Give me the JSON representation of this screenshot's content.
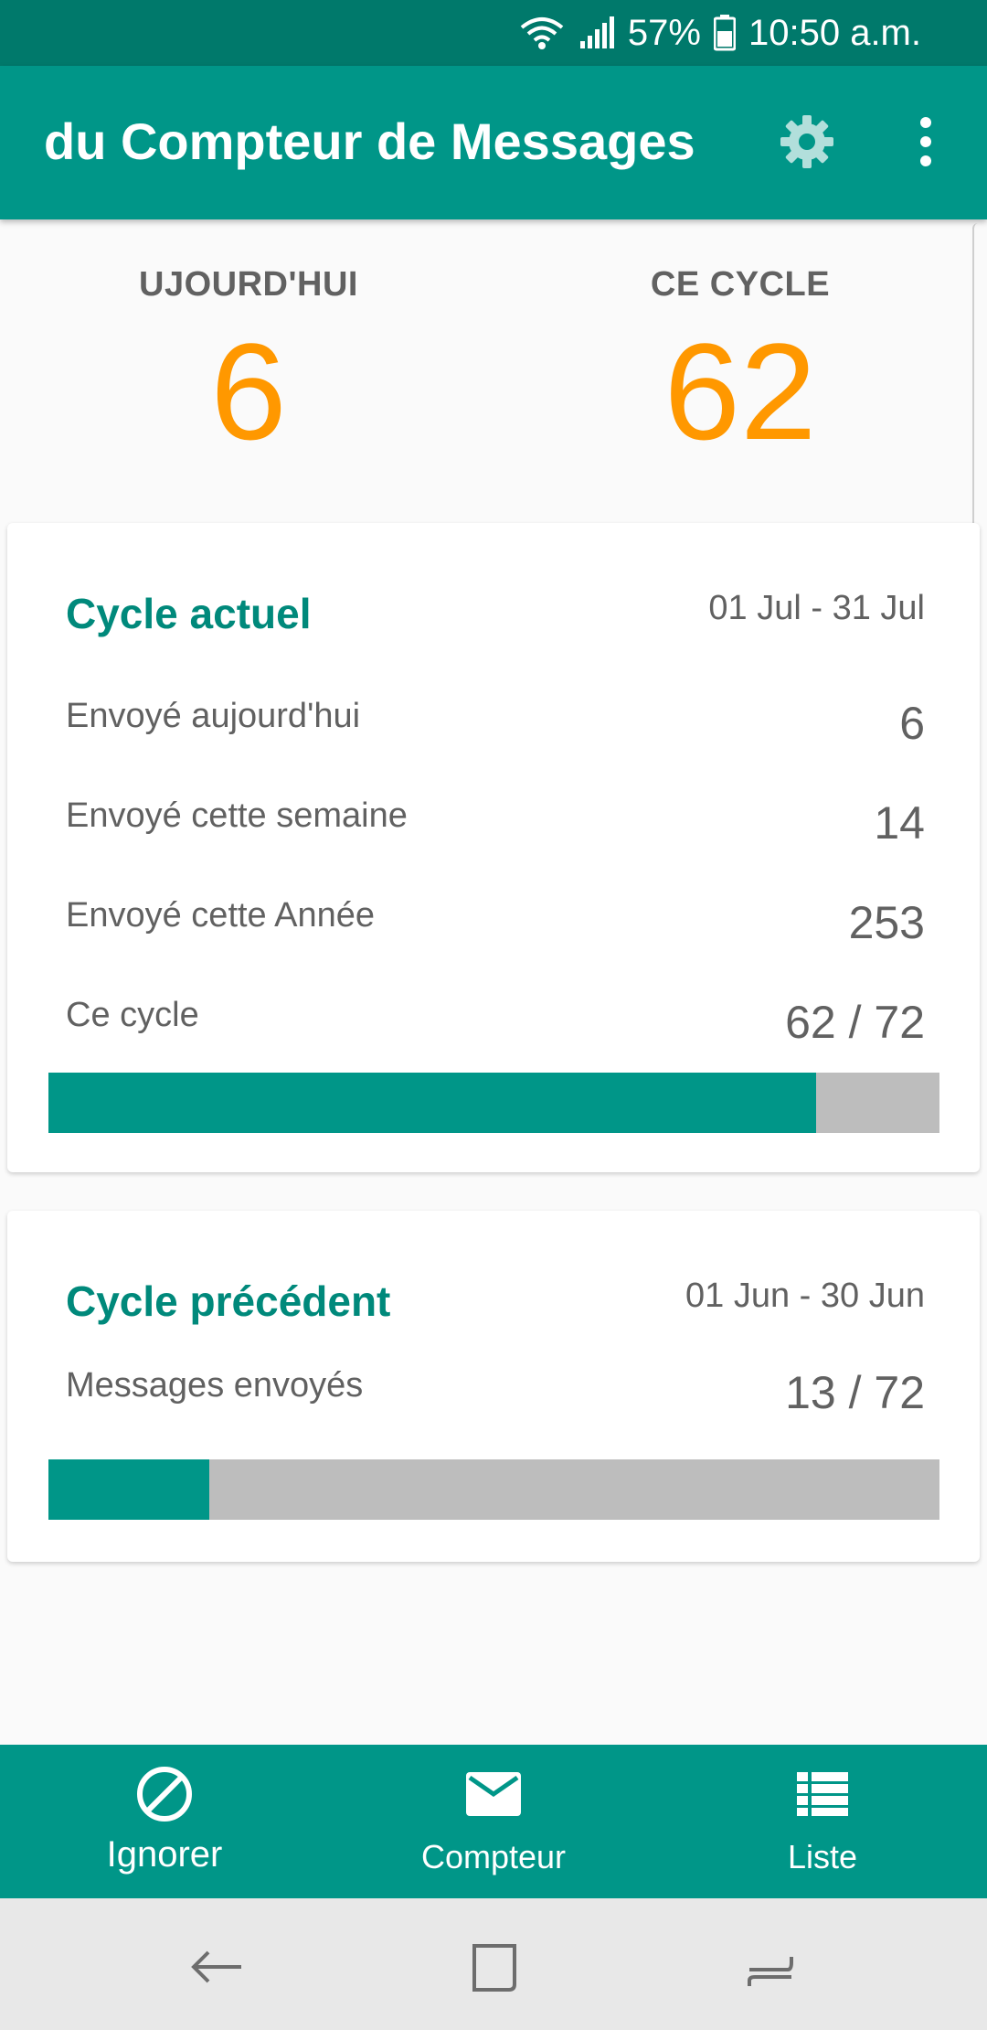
{
  "status_bar": {
    "battery_percent": "57%",
    "time": "10:50 a.m.",
    "icons": [
      "wifi-icon",
      "signal-icon",
      "battery-icon"
    ]
  },
  "app_bar": {
    "title": "du Compteur de Messages",
    "actions": [
      "settings-icon",
      "more-vert-icon"
    ]
  },
  "summary": {
    "today_label": "UJOURD'HUI",
    "today_value": "6",
    "cycle_label": "CE CYCLE",
    "cycle_value": "62"
  },
  "current_cycle": {
    "title": "Cycle actuel",
    "dates": "01 Jul - 31 Jul",
    "rows": [
      {
        "label": "Envoyé aujourd'hui",
        "value": "6"
      },
      {
        "label": "Envoyé cette semaine",
        "value": "14"
      },
      {
        "label": "Envoyé cette Année",
        "value": "253"
      },
      {
        "label": "Ce cycle",
        "value": "62 / 72"
      }
    ],
    "progress_used": 62,
    "progress_limit": 72
  },
  "previous_cycle": {
    "title": "Cycle précédent",
    "dates": "01 Jun - 30 Jun",
    "rows": [
      {
        "label": "Messages envoyés",
        "value": "13 / 72"
      }
    ],
    "progress_used": 13,
    "progress_limit": 72
  },
  "bottom_nav": {
    "items": [
      {
        "label": "Ignorer",
        "icon": "block-icon"
      },
      {
        "label": "Compteur",
        "icon": "mail-icon"
      },
      {
        "label": "Liste",
        "icon": "list-icon"
      }
    ]
  },
  "system_nav": {
    "buttons": [
      "back-icon",
      "home-icon",
      "recents-icon"
    ]
  },
  "colors": {
    "primary": "#009688",
    "primary_dark": "#00796b",
    "accent": "#ff9800",
    "progress_track": "#bdbdbd"
  }
}
